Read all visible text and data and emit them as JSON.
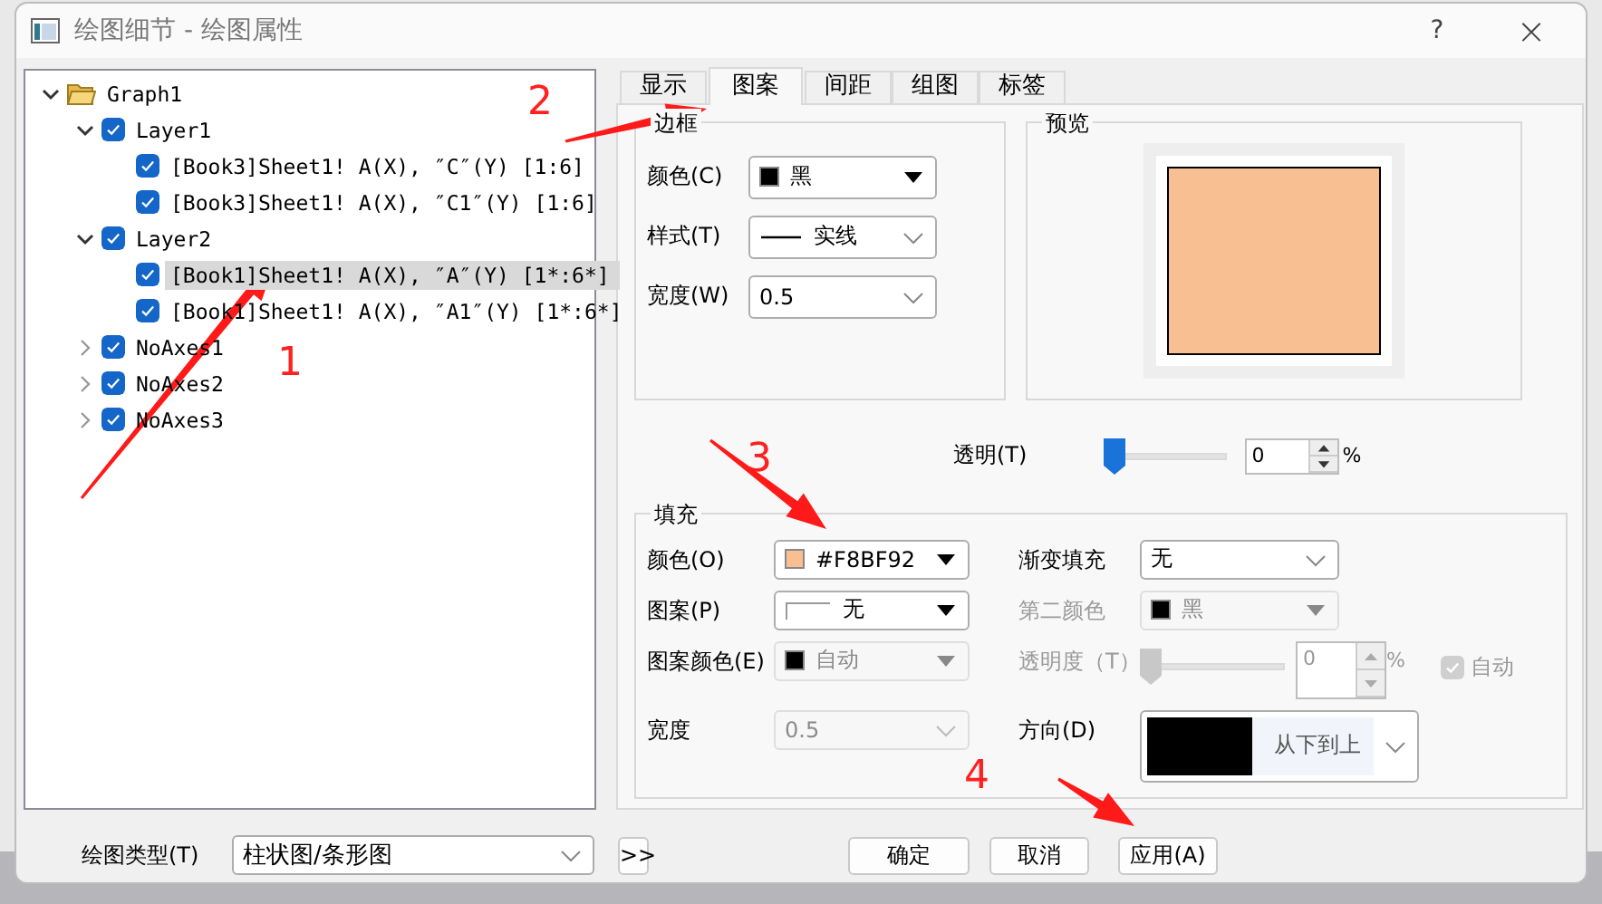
{
  "window": {
    "title": "绘图细节 - 绘图属性",
    "help": "?",
    "close": "×"
  },
  "tree": [
    {
      "label": "Graph1",
      "kind": "folder",
      "expanded": true,
      "selected": false,
      "children": [
        {
          "label": "Layer1",
          "kind": "item",
          "checked": true,
          "expanded": true,
          "selected": false,
          "children": [
            {
              "label": "[Book3]Sheet1! A(X), ″C″(Y) [1:6]",
              "kind": "item",
              "checked": true,
              "selected": false
            },
            {
              "label": "[Book3]Sheet1! A(X), ″C1″(Y) [1:6]",
              "kind": "item",
              "checked": true,
              "selected": false
            }
          ]
        },
        {
          "label": "Layer2",
          "kind": "item",
          "checked": true,
          "expanded": true,
          "selected": false,
          "children": [
            {
              "label": "[Book1]Sheet1! A(X), ″A″(Y) [1*:6*]",
              "kind": "item",
              "checked": true,
              "selected": true
            },
            {
              "label": "[Book1]Sheet1! A(X), ″A1″(Y) [1*:6*]",
              "kind": "item",
              "checked": true,
              "selected": false
            }
          ]
        },
        {
          "label": "NoAxes1",
          "kind": "item",
          "checked": true,
          "expanded": false,
          "selected": false
        },
        {
          "label": "NoAxes2",
          "kind": "item",
          "checked": true,
          "expanded": false,
          "selected": false
        },
        {
          "label": "NoAxes3",
          "kind": "item",
          "checked": true,
          "expanded": false,
          "selected": false
        }
      ]
    }
  ],
  "tabs": [
    {
      "label": "显示",
      "selected": false
    },
    {
      "label": "图案",
      "selected": true
    },
    {
      "label": "间距",
      "selected": false
    },
    {
      "label": "组图",
      "selected": false
    },
    {
      "label": "标签",
      "selected": false
    }
  ],
  "border": {
    "title": "边框",
    "fields": [
      {
        "label": "颜色(C)",
        "kind": "color",
        "value": "黑",
        "color": "#000000",
        "disabled": false
      },
      {
        "label": "样式(T)",
        "kind": "line",
        "value": "实线",
        "disabled": false
      },
      {
        "label": "宽度(W)",
        "kind": "select",
        "value": "0.5",
        "disabled": false
      }
    ]
  },
  "preview": {
    "title": "预览",
    "color": "#f8bf92"
  },
  "transparency": {
    "label": "透明(T)",
    "level": 0,
    "value": "0",
    "unit": "%"
  },
  "fill": {
    "title": "填充",
    "left": [
      {
        "label": "颜色(O)",
        "kind": "color",
        "value": "#F8BF92",
        "color": "#f8bf92",
        "disabled": false
      },
      {
        "label": "图案(P)",
        "kind": "pattern",
        "value": "无",
        "disabled": false
      },
      {
        "label": "图案颜色(E)",
        "kind": "color",
        "value": "自动",
        "color": "#000000",
        "disabled": true
      },
      {
        "label": "宽度",
        "kind": "select",
        "value": "0.5",
        "disabled": true
      }
    ],
    "right": [
      {
        "label": "渐变填充",
        "kind": "select",
        "value": "无",
        "disabled": false
      },
      {
        "label": "第二颜色",
        "kind": "color",
        "value": "黑",
        "color": "#000000",
        "disabled": true
      },
      {
        "label": "透明度（T）",
        "kind": "slider",
        "level": 0,
        "value": "0",
        "unit": "%",
        "check_label": "自动",
        "checked": true,
        "disabled": true
      },
      {
        "label": "方向(D)",
        "kind": "direction",
        "value": "从下到上",
        "color": "#000000",
        "disabled": false
      }
    ]
  },
  "plot_type": {
    "label": "绘图类型(T)",
    "value": "柱状图/条形图"
  },
  "buttons": [
    {
      "label": ">>"
    },
    {
      "label": "确定"
    },
    {
      "label": "取消"
    },
    {
      "label": "应用(A)"
    }
  ],
  "annotations": [
    {
      "label": "1"
    },
    {
      "label": "2"
    },
    {
      "label": "3"
    },
    {
      "label": "4"
    }
  ]
}
